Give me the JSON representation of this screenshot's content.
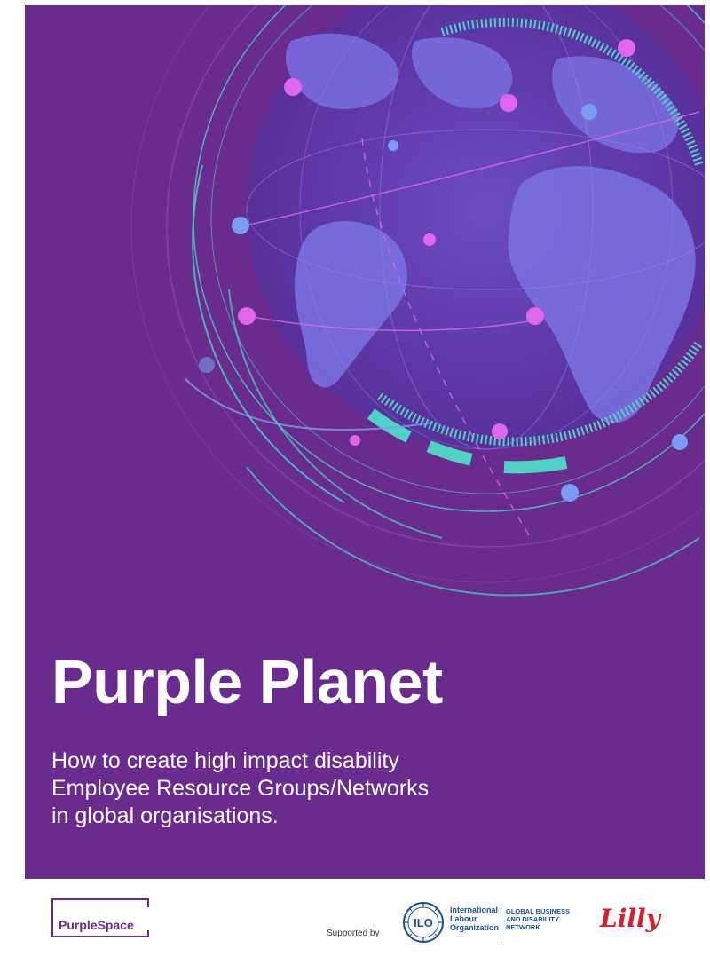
{
  "cover": {
    "title": "Purple Planet",
    "subtitle_lines": [
      "How to create high impact disability",
      "Employee Resource Groups/Networks",
      "in global organisations."
    ]
  },
  "footer": {
    "publisher_logo_text": "PurpleSpace",
    "supported_by": "Supported by",
    "ilo_lines": [
      "International",
      "Labour",
      "Organization"
    ],
    "ilo_emblem_text": "ILO",
    "gbdn_lines": [
      "GLOBAL BUSINESS",
      "AND DISABILITY",
      "NETWORK"
    ],
    "lilly_logo_text": "Lilly"
  },
  "colors": {
    "background_purple": "#6a2b8e",
    "globe_ocean": "#5b3aa8",
    "continents": "#7a6fe0",
    "ring_teal": "#4fd1c5",
    "node_pink": "#e066ee",
    "node_blue": "#7a9cf0",
    "ilo_blue": "#1b4f9c",
    "lilly_red": "#d2202f"
  },
  "icons": [
    "globe-graphic",
    "ilo-emblem-icon"
  ]
}
